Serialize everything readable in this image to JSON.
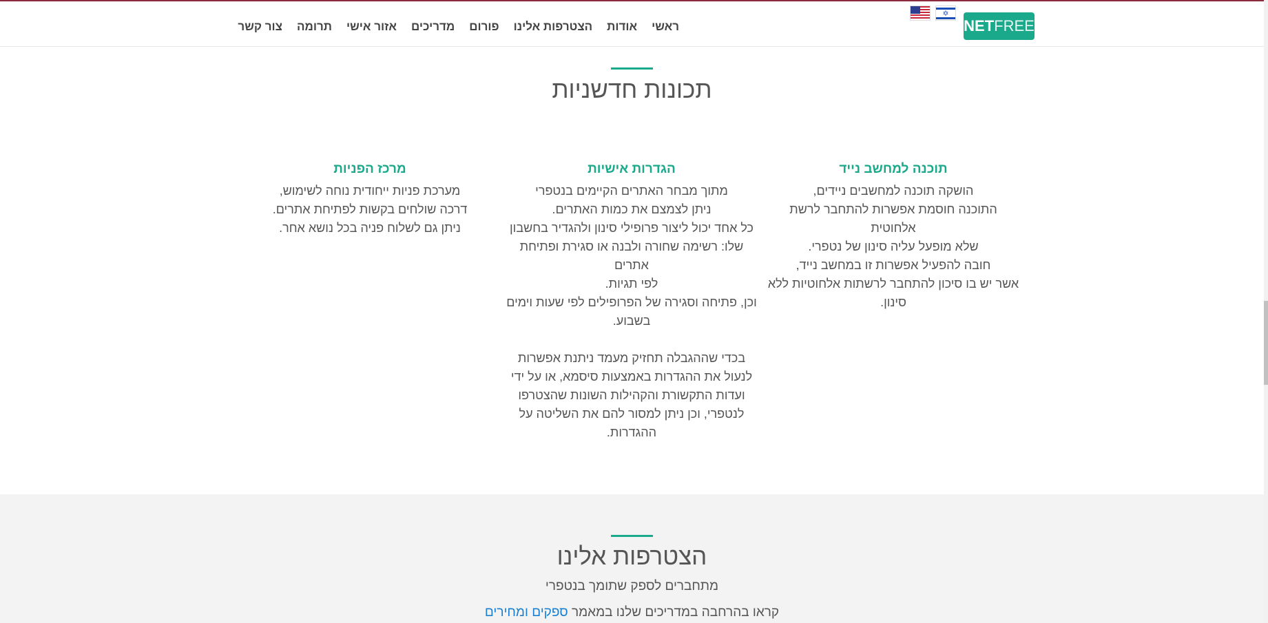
{
  "header": {
    "logo_text_bold": "NET",
    "logo_text_light": "FREE",
    "nav": [
      {
        "label": "ראשי"
      },
      {
        "label": "אודות"
      },
      {
        "label": "הצטרפות אלינו"
      },
      {
        "label": "פורום"
      },
      {
        "label": "מדריכים"
      },
      {
        "label": "אזור אישי"
      },
      {
        "label": "תרומה"
      },
      {
        "label": "צור קשר"
      }
    ],
    "flag_il_symbol": "✡"
  },
  "features_section": {
    "title": "תכונות חדשניות",
    "items": [
      {
        "title": "תוכנה למחשב נייד",
        "text": "הושקה תוכנה למחשבים ניידים,\nהתוכנה חוסמת אפשרות להתחבר לרשת אלחוטית\nשלא מופעל עליה סינון של נטפרי.\nחובה להפעיל אפשרות זו במחשב נייד,\nאשר יש בו סיכון להתחבר לרשתות אלחוטיות ללא\nסינון."
      },
      {
        "title": "הגדרות אישיות",
        "text": "מתוך מבחר האתרים הקיימים בנטפרי\nניתן לצמצם את כמות האתרים.\nכל אחד יכול ליצור פרופילי סינון ולהגדיר בחשבון\nשלו: רשימה שחורה ולבנה או סגירת ופתיחת אתרים\nלפי תגיות.\nוכן, פתיחה וסגירה של הפרופילים לפי שעות וימים\nבשבוע.\n\nבכדי שההגבלה תחזיק מעמד ניתנת אפשרות\nלנעול את ההגדרות באמצעות סיסמא, או על ידי\nועדות התקשורת והקהילות השונות שהצטרפו\nלנטפרי, וכן ניתן למסור להם את השליטה על\nההגדרות."
      },
      {
        "title": "מרכז הפניות",
        "text": "מערכת פניות ייחודית נוחה לשימוש,\nדרכה שולחים בקשות לפתיחת אתרים.\nניתן גם לשלוח פניה בכל נושא אחר."
      }
    ]
  },
  "join_section": {
    "title": "הצטרפות אלינו",
    "subtitle": "מתחברים לספק שתומך בנטפרי",
    "read_more_prefix": "קראו בהרחבה במדריכים שלנו במאמר ",
    "read_more_link": "ספקים ומחירים"
  },
  "colors": {
    "accent": "#1aaa8b",
    "top_line": "#8a2b3d",
    "link": "#1a7fd0",
    "gray_bg": "#f3f3f3"
  }
}
